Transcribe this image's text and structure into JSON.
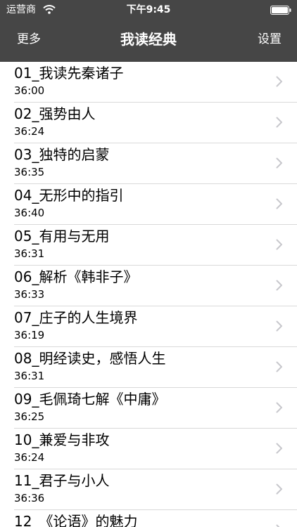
{
  "status_bar": {
    "carrier": "运营商",
    "time": "下午9:45"
  },
  "nav": {
    "left_label": "更多",
    "title": "我读经典",
    "right_label": "设置"
  },
  "episodes": [
    {
      "title": "01_我读先秦诸子",
      "duration": "36:00"
    },
    {
      "title": "02_强势由人",
      "duration": "36:24"
    },
    {
      "title": "03_独特的启蒙",
      "duration": "36:35"
    },
    {
      "title": "04_无形中的指引",
      "duration": "36:40"
    },
    {
      "title": "05_有用与无用",
      "duration": "36:31"
    },
    {
      "title": "06_解析《韩非子》",
      "duration": "36:33"
    },
    {
      "title": "07_庄子的人生境界",
      "duration": "36:19"
    },
    {
      "title": "08_明经读史，感悟人生",
      "duration": "36:31"
    },
    {
      "title": "09_毛佩琦七解《中庸》",
      "duration": "36:25"
    },
    {
      "title": "10_兼爱与非攻",
      "duration": "36:24"
    },
    {
      "title": "11_君子与小人",
      "duration": "36:36"
    },
    {
      "title": "12_《论语》的魅力",
      "duration": ""
    }
  ],
  "colors": {
    "navbar_bg": "#464646",
    "separator": "#d9d9d9",
    "chevron": "#c7c7cc"
  },
  "icons": {
    "wifi": "wifi-icon",
    "battery": "battery-icon",
    "row_accessory": "chevron-right-icon"
  }
}
